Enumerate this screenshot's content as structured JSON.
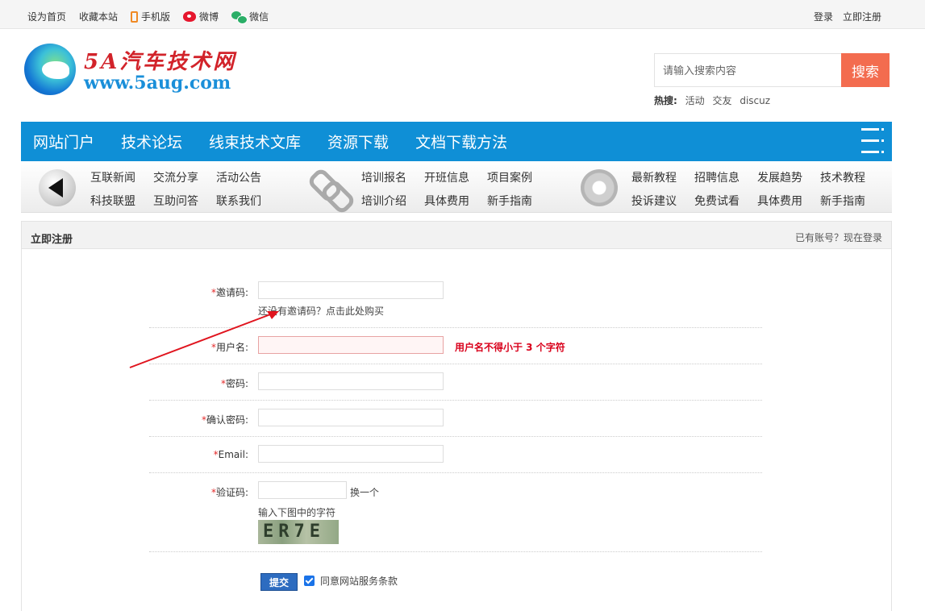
{
  "topbar": {
    "set_home": "设为首页",
    "favorite": "收藏本站",
    "mobile": "手机版",
    "weibo": "微博",
    "wechat": "微信",
    "login": "登录",
    "register": "立即注册"
  },
  "logo": {
    "cn": "5A汽车技术网",
    "en": "www.5aug.com"
  },
  "search": {
    "placeholder": "请输入搜索内容",
    "button": "搜索",
    "hot_label": "热搜:",
    "hot_keywords": [
      "活动",
      "交友",
      "discuz"
    ]
  },
  "nav": {
    "items": [
      "网站门户",
      "技术论坛",
      "线束技术文库",
      "资源下载",
      "文档下载方法"
    ]
  },
  "subnav": {
    "group1": [
      "互联新闻",
      "交流分享",
      "活动公告",
      "科技联盟",
      "互助问答",
      "联系我们"
    ],
    "group2": [
      "培训报名",
      "开班信息",
      "项目案例",
      "培训介绍",
      "具体费用",
      "新手指南"
    ],
    "group3": [
      "最新教程",
      "招聘信息",
      "发展趋势",
      "技术教程",
      "投诉建议",
      "免费试看",
      "具体费用",
      "新手指南"
    ]
  },
  "panel": {
    "title": "立即注册",
    "has_account": "已有账号？现在登录"
  },
  "form": {
    "required_mark": "*",
    "invite_label": "邀请码:",
    "invite_hint": "还没有邀请码？点击此处购买",
    "username_label": "用户名:",
    "username_error": "用户名不得小于 3 个字符",
    "password_label": "密码:",
    "confirm_label": "确认密码:",
    "email_label": "Email:",
    "captcha_label": "验证码:",
    "captcha_refresh": "换一个",
    "captcha_hint": "输入下图中的字符",
    "captcha_text": "ER7E",
    "submit": "提交",
    "agree": "同意网站服务条款"
  },
  "colors": {
    "nav_blue": "#0f8fd6",
    "search_button": "#f36c4f",
    "error_red": "#d9001b",
    "submit_blue": "#2d6cc0"
  }
}
